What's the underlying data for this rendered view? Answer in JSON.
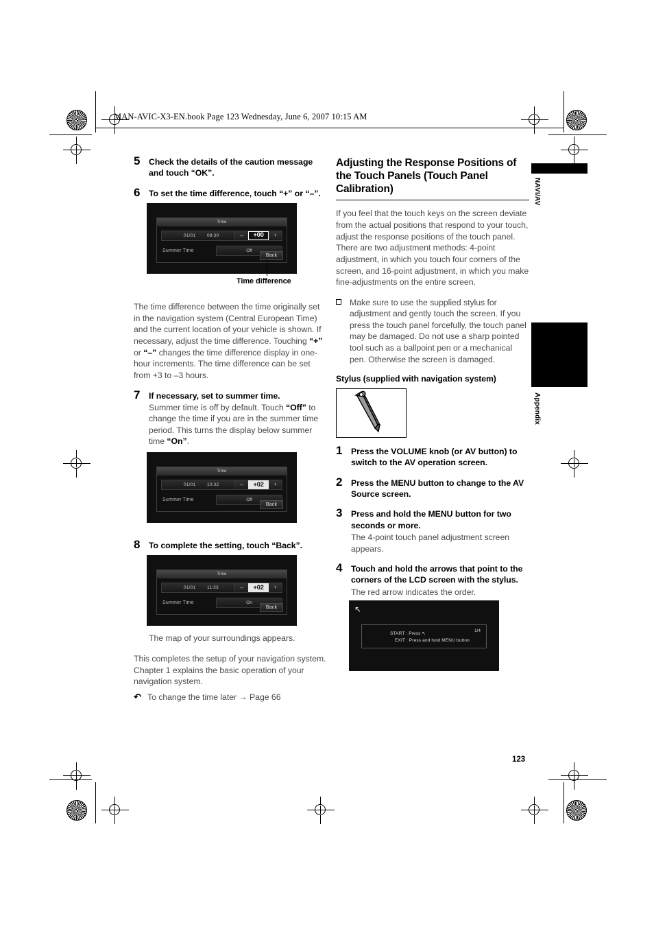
{
  "header": {
    "file_line": "MAN-AVIC-X3-EN.book  Page 123  Wednesday, June 6, 2007  10:15 AM"
  },
  "page_number": "123",
  "side_tabs": [
    {
      "label": "NAVI/AV"
    },
    {
      "label": "Appendix"
    }
  ],
  "left_column": {
    "step5": {
      "num": "5",
      "title": "Check the details of the caution message and touch “OK”."
    },
    "step6": {
      "num": "6",
      "title": "To set the time difference, touch “+” or “–”."
    },
    "screen1": {
      "title": "Time",
      "date": "01/01",
      "time": "08:30",
      "minus": "–",
      "plus": "+",
      "offset": "+00",
      "summer_label": "Summer Time",
      "summer_value": "Off",
      "back": "Back"
    },
    "callout": {
      "label": "Time difference"
    },
    "para_time_difference": "The time difference between the time originally set in the navigation system (Central European Time) and the current location of your vehicle is shown. If necessary, adjust the time difference. Touching “+” or “–” changes the time difference display in one-hour increments. The time difference can be set from +3 to –3 hours.",
    "step7": {
      "num": "7",
      "title": "If necessary, set to summer time.",
      "body": "Summer time is off by default. Touch “Off” to change the time if you are in the summer time period. This turns the display below summer time “On”."
    },
    "screen2": {
      "title": "Time",
      "date": "01/01",
      "time": "10:32",
      "minus": "–",
      "plus": "+",
      "offset": "+02",
      "summer_label": "Summer Time",
      "summer_value": "Off",
      "back": "Back"
    },
    "step8": {
      "num": "8",
      "title": "To complete the setting, touch “Back”."
    },
    "screen3": {
      "title": "Time",
      "date": "01/01",
      "time": "11:33",
      "minus": "–",
      "plus": "+",
      "offset": "+02",
      "summer_label": "Summer Time",
      "summer_value": "On",
      "back": "Back"
    },
    "para_map": "The map of your surroundings appears.",
    "para_complete": "This completes the setup of your navigation system. Chapter 1 explains the basic operation of your navigation system.",
    "reference": "To change the time later → Page 66"
  },
  "right_column": {
    "heading": "Adjusting the Response Positions of the Touch Panels (Touch Panel Calibration)",
    "intro": "If you feel that the touch keys on the screen deviate from the actual positions that respond to your touch, adjust the response positions of the touch panel. There are two adjustment methods: 4-point adjustment, in which you touch four corners of the screen, and 16-point adjustment, in which you make fine-adjustments on the entire screen.",
    "note": "Make sure to use the supplied stylus for adjustment and gently touch the screen. If you press the touch panel forcefully, the touch panel may be damaged. Do not use a sharp pointed tool such as a ballpoint pen or a mechanical pen. Otherwise the screen is damaged.",
    "stylus_heading": "Stylus (supplied with navigation system)",
    "step1": {
      "num": "1",
      "title": "Press the VOLUME knob (or AV button) to switch to the AV operation screen."
    },
    "step2": {
      "num": "2",
      "title": "Press the MENU button to change to the AV Source screen."
    },
    "step3": {
      "num": "3",
      "title": "Press and hold the MENU button for two seconds or more.",
      "body": "The 4-point touch panel adjustment screen appears."
    },
    "step4": {
      "num": "4",
      "title": "Touch and hold the arrows that point to the corners of the LCD screen with the stylus.",
      "body": "The red arrow indicates the order."
    },
    "calibration_screen": {
      "start_line": "START : Press ↖",
      "exit_line": "EXIT : Press and hold MENU button",
      "counter": "1/4"
    }
  }
}
